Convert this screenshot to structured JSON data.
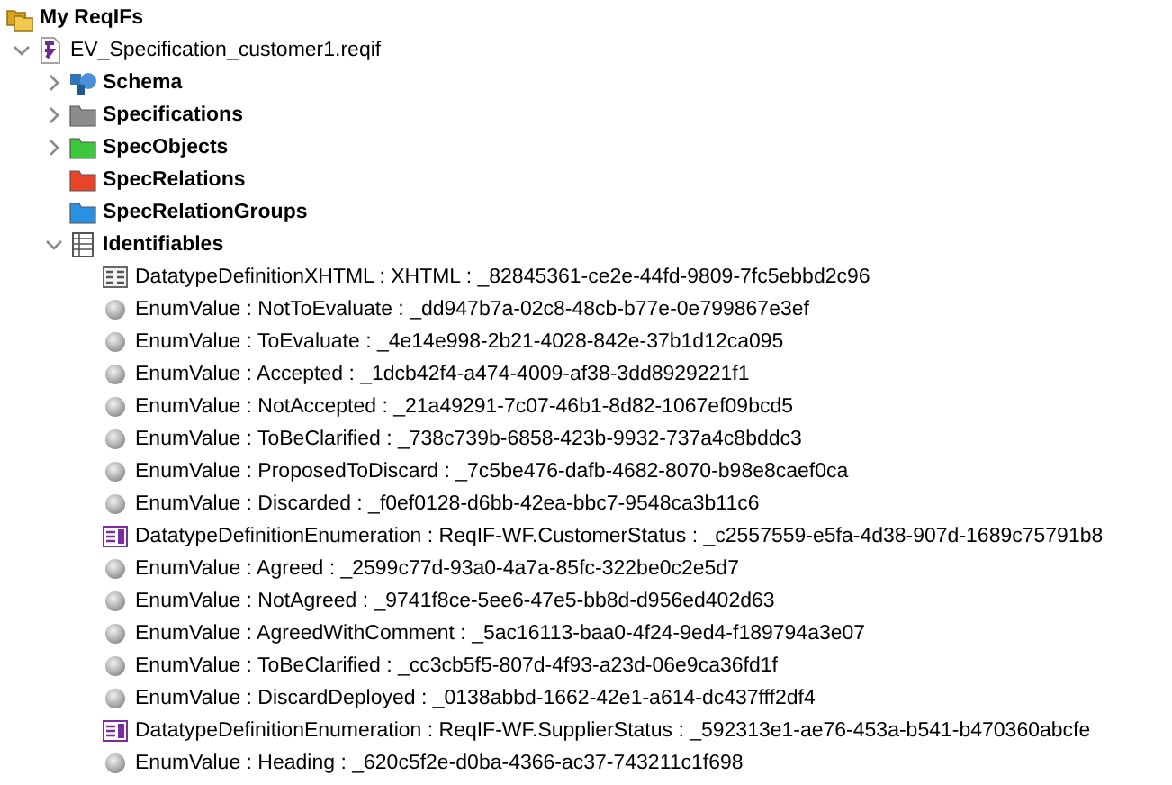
{
  "tree": [
    {
      "label": "My ReqIFs",
      "kind": "repository",
      "children": [
        {
          "label": "EV_Specification_customer1.reqif",
          "kind": "reqif-file",
          "expanded": true,
          "children": [
            {
              "label": "Schema",
              "kind": "schema",
              "expanded": false
            },
            {
              "label": "Specifications",
              "kind": "folder",
              "color": "#8c8c8c",
              "expanded": false
            },
            {
              "label": "SpecObjects",
              "kind": "folder",
              "color": "#3cc83c",
              "expanded": false
            },
            {
              "label": "SpecRelations",
              "kind": "folder",
              "color": "#e8442a"
            },
            {
              "label": "SpecRelationGroups",
              "kind": "folder",
              "color": "#2a90e0"
            },
            {
              "label": "Identifiables",
              "kind": "table",
              "expanded": true,
              "children": [
                {
                  "label": "DatatypeDefinitionXHTML : XHTML : _82845361-ce2e-44fd-9809-7fc5ebbd2c96",
                  "kind": "xhtml-datatype"
                },
                {
                  "label": "EnumValue : NotToEvaluate : _dd947b7a-02c8-48cb-b77e-0e799867e3ef",
                  "kind": "enum-value"
                },
                {
                  "label": "EnumValue : ToEvaluate : _4e14e998-2b21-4028-842e-37b1d12ca095",
                  "kind": "enum-value"
                },
                {
                  "label": "EnumValue : Accepted : _1dcb42f4-a474-4009-af38-3dd8929221f1",
                  "kind": "enum-value"
                },
                {
                  "label": "EnumValue : NotAccepted : _21a49291-7c07-46b1-8d82-1067ef09bcd5",
                  "kind": "enum-value"
                },
                {
                  "label": "EnumValue : ToBeClarified : _738c739b-6858-423b-9932-737a4c8bddc3",
                  "kind": "enum-value"
                },
                {
                  "label": "EnumValue : ProposedToDiscard : _7c5be476-dafb-4682-8070-b98e8caef0ca",
                  "kind": "enum-value"
                },
                {
                  "label": "EnumValue : Discarded : _f0ef0128-d6bb-42ea-bbc7-9548ca3b11c6",
                  "kind": "enum-value"
                },
                {
                  "label": "DatatypeDefinitionEnumeration : ReqIF-WF.CustomerStatus : _c2557559-e5fa-4d38-907d-1689c75791b8",
                  "kind": "enumeration-datatype"
                },
                {
                  "label": "EnumValue : Agreed : _2599c77d-93a0-4a7a-85fc-322be0c2e5d7",
                  "kind": "enum-value"
                },
                {
                  "label": "EnumValue : NotAgreed : _9741f8ce-5ee6-47e5-bb8d-d956ed402d63",
                  "kind": "enum-value"
                },
                {
                  "label": "EnumValue : AgreedWithComment : _5ac16113-baa0-4f24-9ed4-f189794a3e07",
                  "kind": "enum-value"
                },
                {
                  "label": "EnumValue : ToBeClarified : _cc3cb5f5-807d-4f93-a23d-06e9ca36fd1f",
                  "kind": "enum-value"
                },
                {
                  "label": "EnumValue : DiscardDeployed : _0138abbd-1662-42e1-a614-dc437fff2df4",
                  "kind": "enum-value"
                },
                {
                  "label": "DatatypeDefinitionEnumeration : ReqIF-WF.SupplierStatus : _592313e1-ae76-453a-b541-b470360abcfe",
                  "kind": "enumeration-datatype"
                },
                {
                  "label": "EnumValue : Heading : _620c5f2e-d0ba-4366-ac37-743211c1f698",
                  "kind": "enum-value"
                }
              ]
            }
          ]
        }
      ]
    }
  ]
}
